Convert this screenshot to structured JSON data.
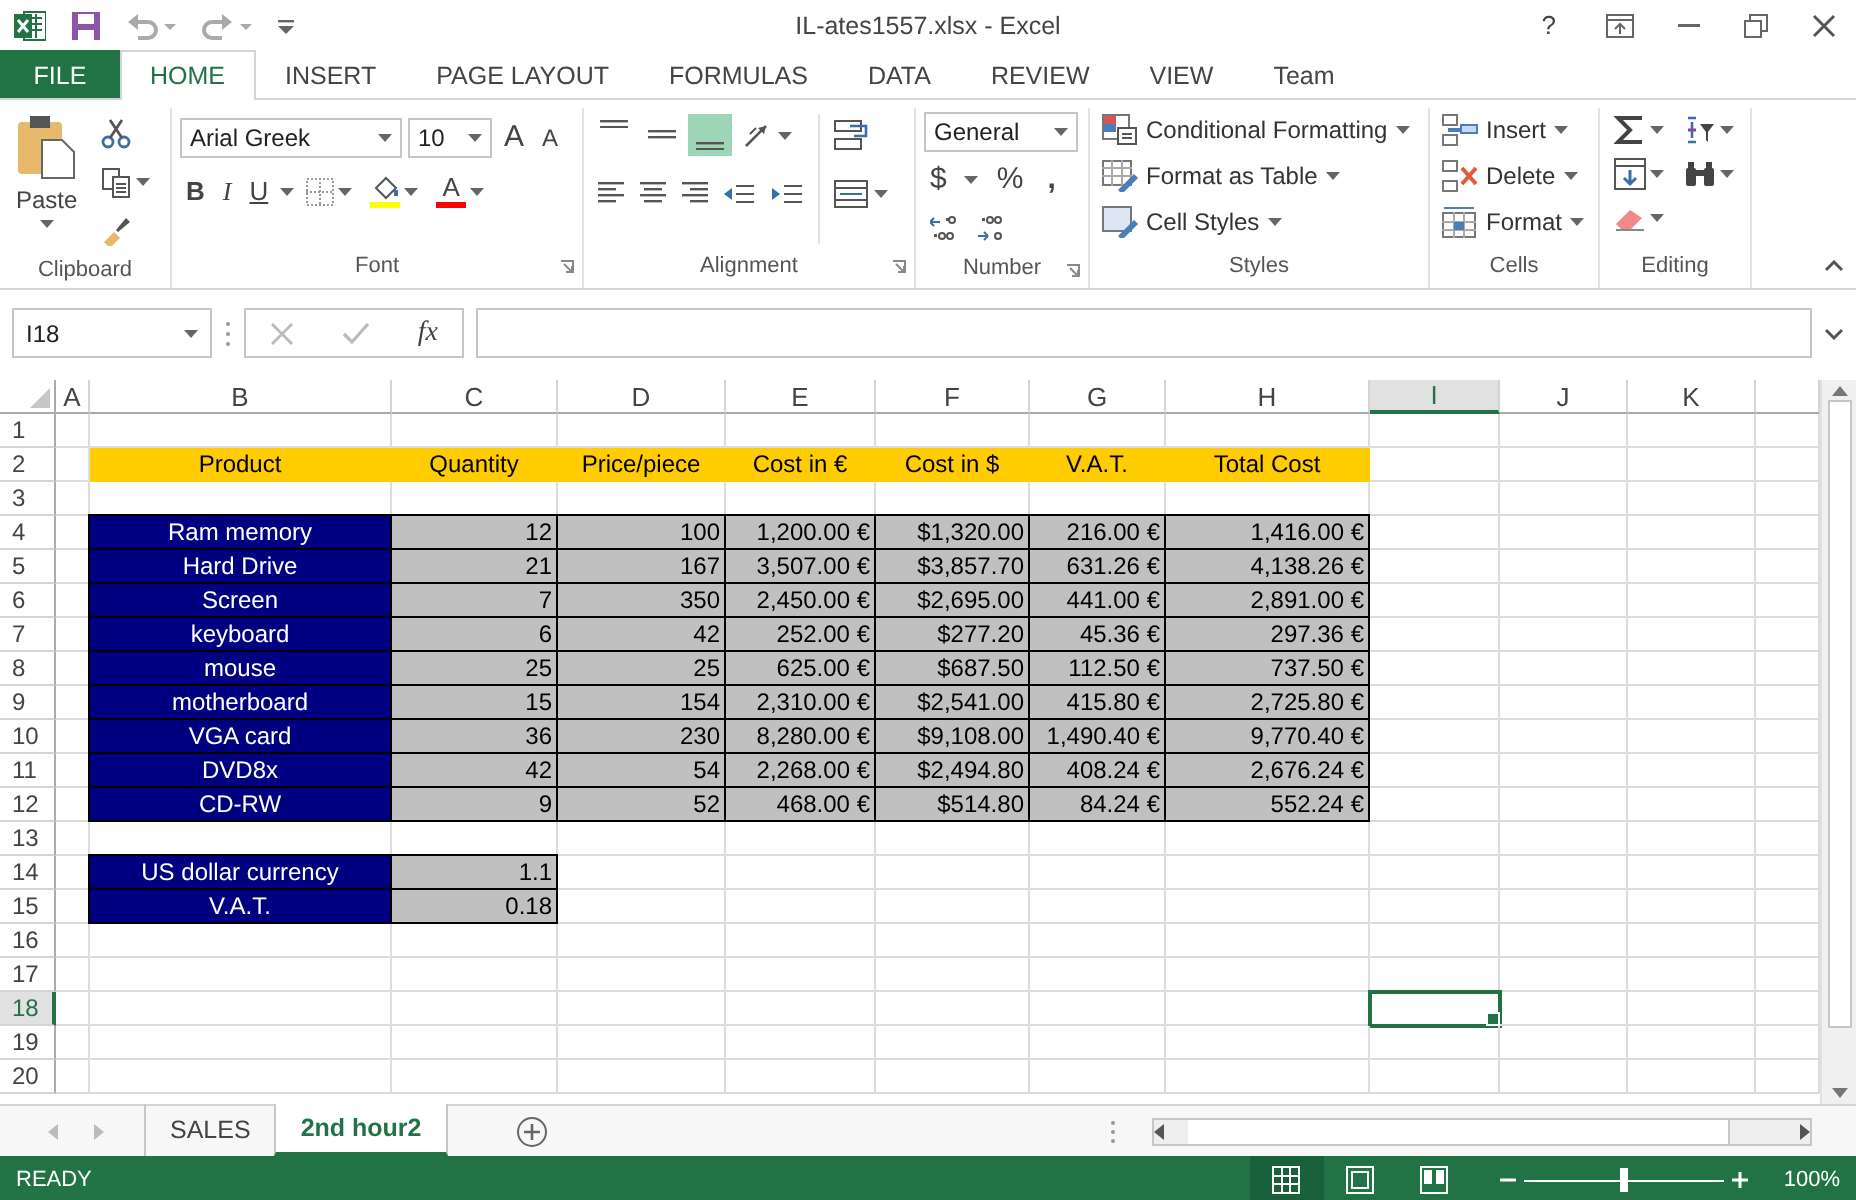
{
  "window": {
    "title": "IL-ates1557.xlsx - Excel",
    "help": "?"
  },
  "ribbon_tabs": [
    {
      "label": "FILE",
      "kind": "file",
      "selected": false
    },
    {
      "label": "HOME",
      "kind": "tab",
      "selected": true
    },
    {
      "label": "INSERT",
      "kind": "tab",
      "selected": false
    },
    {
      "label": "PAGE LAYOUT",
      "kind": "tab",
      "selected": false
    },
    {
      "label": "FORMULAS",
      "kind": "tab",
      "selected": false
    },
    {
      "label": "DATA",
      "kind": "tab",
      "selected": false
    },
    {
      "label": "REVIEW",
      "kind": "tab",
      "selected": false
    },
    {
      "label": "VIEW",
      "kind": "tab",
      "selected": false
    },
    {
      "label": "Team",
      "kind": "tab",
      "selected": false
    }
  ],
  "clipboard": {
    "paste": "Paste",
    "label": "Clipboard"
  },
  "font": {
    "name": "Arial Greek",
    "size": "10",
    "grow": "A",
    "shrink": "A",
    "bold": "B",
    "italic": "I",
    "underline": "U",
    "color_letter": "A",
    "label": "Font"
  },
  "alignment": {
    "vertical": [
      {
        "selected": false
      },
      {
        "selected": false
      },
      {
        "selected": true
      }
    ],
    "label": "Alignment"
  },
  "number": {
    "format": "General",
    "currency": "$",
    "percent": "%",
    "comma": ",",
    "label": "Number"
  },
  "styles": {
    "items": [
      "Conditional Formatting",
      "Format as Table",
      "Cell Styles"
    ],
    "label": "Styles"
  },
  "cells": {
    "items": [
      "Insert",
      "Delete",
      "Format"
    ],
    "label": "Cells"
  },
  "editing": {
    "label": "Editing"
  },
  "formula_bar": {
    "name_box": "I18",
    "fx": "fx"
  },
  "columns": [
    {
      "label": "A",
      "selected": false
    },
    {
      "label": "B",
      "selected": false
    },
    {
      "label": "C",
      "selected": false
    },
    {
      "label": "D",
      "selected": false
    },
    {
      "label": "E",
      "selected": false
    },
    {
      "label": "F",
      "selected": false
    },
    {
      "label": "G",
      "selected": false
    },
    {
      "label": "H",
      "selected": false
    },
    {
      "label": "I",
      "selected": true
    },
    {
      "label": "J",
      "selected": false
    },
    {
      "label": "K",
      "selected": false
    }
  ],
  "rows": [
    {
      "number": "1",
      "selected": false
    },
    {
      "number": "2",
      "selected": false,
      "cells": [
        {
          "kind": "header",
          "text": "Product"
        },
        {
          "kind": "header",
          "text": "Quantity"
        },
        {
          "kind": "header",
          "text": "Price/piece"
        },
        {
          "kind": "header",
          "text": "Cost in €"
        },
        {
          "kind": "header",
          "text": "Cost in $"
        },
        {
          "kind": "header",
          "text": "V.A.T."
        },
        {
          "kind": "header",
          "text": "Total Cost"
        }
      ]
    },
    {
      "number": "3",
      "selected": false
    },
    {
      "number": "4",
      "selected": false,
      "cells": [
        {
          "kind": "label",
          "text": "Ram memory"
        },
        {
          "kind": "number",
          "text": "12"
        },
        {
          "kind": "number",
          "text": "100"
        },
        {
          "kind": "number",
          "text": "1,200.00 €"
        },
        {
          "kind": "number",
          "text": "$1,320.00"
        },
        {
          "kind": "number",
          "text": "216.00 €"
        },
        {
          "kind": "number",
          "text": "1,416.00 €"
        }
      ]
    },
    {
      "number": "5",
      "selected": false,
      "cells": [
        {
          "kind": "label",
          "text": "Hard Drive"
        },
        {
          "kind": "number",
          "text": "21"
        },
        {
          "kind": "number",
          "text": "167"
        },
        {
          "kind": "number",
          "text": "3,507.00 €"
        },
        {
          "kind": "number",
          "text": "$3,857.70"
        },
        {
          "kind": "number",
          "text": "631.26 €"
        },
        {
          "kind": "number",
          "text": "4,138.26 €"
        }
      ]
    },
    {
      "number": "6",
      "selected": false,
      "cells": [
        {
          "kind": "label",
          "text": "Screen"
        },
        {
          "kind": "number",
          "text": "7"
        },
        {
          "kind": "number",
          "text": "350"
        },
        {
          "kind": "number",
          "text": "2,450.00 €"
        },
        {
          "kind": "number",
          "text": "$2,695.00"
        },
        {
          "kind": "number",
          "text": "441.00 €"
        },
        {
          "kind": "number",
          "text": "2,891.00 €"
        }
      ]
    },
    {
      "number": "7",
      "selected": false,
      "cells": [
        {
          "kind": "label",
          "text": "keyboard"
        },
        {
          "kind": "number",
          "text": "6"
        },
        {
          "kind": "number",
          "text": "42"
        },
        {
          "kind": "number",
          "text": "252.00 €"
        },
        {
          "kind": "number",
          "text": "$277.20"
        },
        {
          "kind": "number",
          "text": "45.36 €"
        },
        {
          "kind": "number",
          "text": "297.36 €"
        }
      ]
    },
    {
      "number": "8",
      "selected": false,
      "cells": [
        {
          "kind": "label",
          "text": "mouse"
        },
        {
          "kind": "number",
          "text": "25"
        },
        {
          "kind": "number",
          "text": "25"
        },
        {
          "kind": "number",
          "text": "625.00 €"
        },
        {
          "kind": "number",
          "text": "$687.50"
        },
        {
          "kind": "number",
          "text": "112.50 €"
        },
        {
          "kind": "number",
          "text": "737.50 €"
        }
      ]
    },
    {
      "number": "9",
      "selected": false,
      "cells": [
        {
          "kind": "label",
          "text": "motherboard"
        },
        {
          "kind": "number",
          "text": "15"
        },
        {
          "kind": "number",
          "text": "154"
        },
        {
          "kind": "number",
          "text": "2,310.00 €"
        },
        {
          "kind": "number",
          "text": "$2,541.00"
        },
        {
          "kind": "number",
          "text": "415.80 €"
        },
        {
          "kind": "number",
          "text": "2,725.80 €"
        }
      ]
    },
    {
      "number": "10",
      "selected": false,
      "cells": [
        {
          "kind": "label",
          "text": "VGA card"
        },
        {
          "kind": "number",
          "text": "36"
        },
        {
          "kind": "number",
          "text": "230"
        },
        {
          "kind": "number",
          "text": "8,280.00 €"
        },
        {
          "kind": "number",
          "text": "$9,108.00"
        },
        {
          "kind": "number",
          "text": "1,490.40 €"
        },
        {
          "kind": "number",
          "text": "9,770.40 €"
        }
      ]
    },
    {
      "number": "11",
      "selected": false,
      "cells": [
        {
          "kind": "label",
          "text": "DVD8x"
        },
        {
          "kind": "number",
          "text": "42"
        },
        {
          "kind": "number",
          "text": "54"
        },
        {
          "kind": "number",
          "text": "2,268.00 €"
        },
        {
          "kind": "number",
          "text": "$2,494.80"
        },
        {
          "kind": "number",
          "text": "408.24 €"
        },
        {
          "kind": "number",
          "text": "2,676.24 €"
        }
      ]
    },
    {
      "number": "12",
      "selected": false,
      "cells": [
        {
          "kind": "label",
          "text": "CD-RW"
        },
        {
          "kind": "number",
          "text": "9"
        },
        {
          "kind": "number",
          "text": "52"
        },
        {
          "kind": "number",
          "text": "468.00 €"
        },
        {
          "kind": "number",
          "text": "$514.80"
        },
        {
          "kind": "number",
          "text": "84.24 €"
        },
        {
          "kind": "number",
          "text": "552.24 €"
        }
      ]
    },
    {
      "number": "13",
      "selected": false
    },
    {
      "number": "14",
      "selected": false,
      "cells": [
        {
          "kind": "label",
          "text": "US dollar currency"
        },
        {
          "kind": "number",
          "text": "1.1"
        }
      ]
    },
    {
      "number": "15",
      "selected": false,
      "cells": [
        {
          "kind": "label",
          "text": "V.A.T."
        },
        {
          "kind": "number",
          "text": "0.18"
        }
      ]
    },
    {
      "number": "16",
      "selected": false
    },
    {
      "number": "17",
      "selected": false
    },
    {
      "number": "18",
      "selected": true
    },
    {
      "number": "19",
      "selected": false
    },
    {
      "number": "20",
      "selected": false
    }
  ],
  "sheet_tabs": [
    {
      "label": "SALES",
      "selected": false
    },
    {
      "label": "2nd hour2",
      "selected": true
    }
  ],
  "status_bar": {
    "status": "READY",
    "views": [
      {
        "selected": true
      },
      {
        "selected": false
      },
      {
        "selected": false
      }
    ],
    "zoom": {
      "level": 0.5,
      "reading": "100%"
    }
  }
}
